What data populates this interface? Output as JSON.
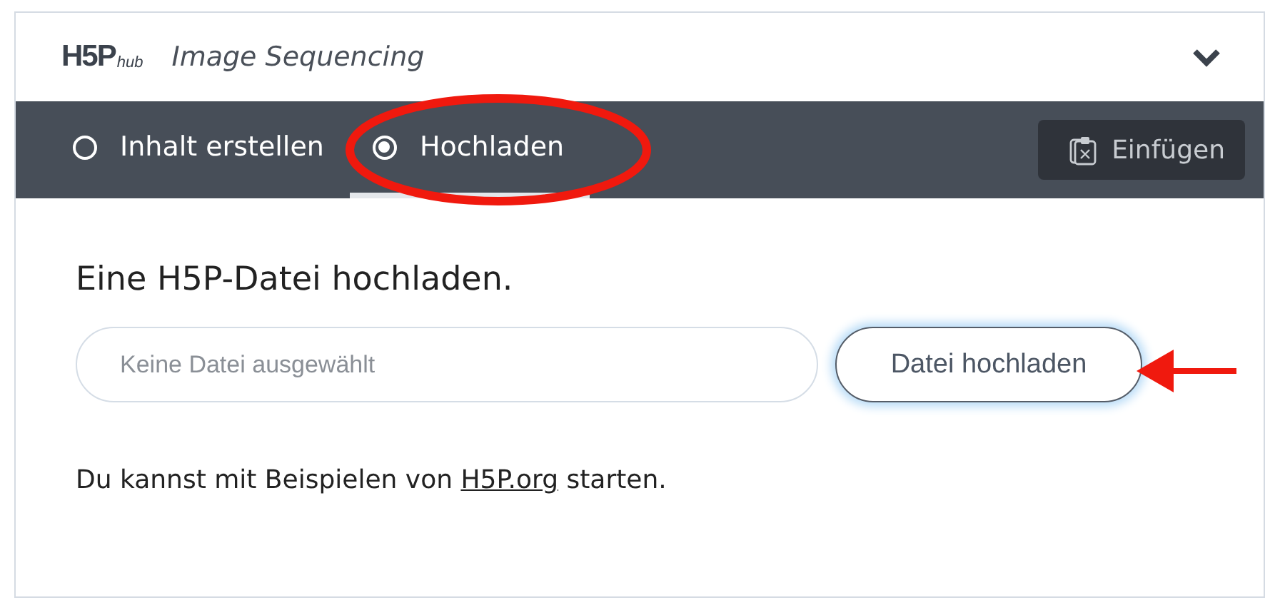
{
  "header": {
    "logo": {
      "mark": "H5P",
      "suffix": "hub"
    },
    "title": "Image Sequencing",
    "expanded": true
  },
  "tabs": [
    {
      "label": "Inhalt erstellen",
      "selected": false
    },
    {
      "label": "Hochladen",
      "selected": true
    }
  ],
  "paste_button": "Einfügen",
  "upload": {
    "heading": "Eine H5P-Datei hochladen.",
    "file_field": {
      "placeholder": "Keine Datei ausgewählt"
    },
    "button": "Datei hochladen"
  },
  "examples": {
    "before": "Du kannst mit Beispielen von ",
    "link": "H5P.org",
    "after": " starten."
  }
}
